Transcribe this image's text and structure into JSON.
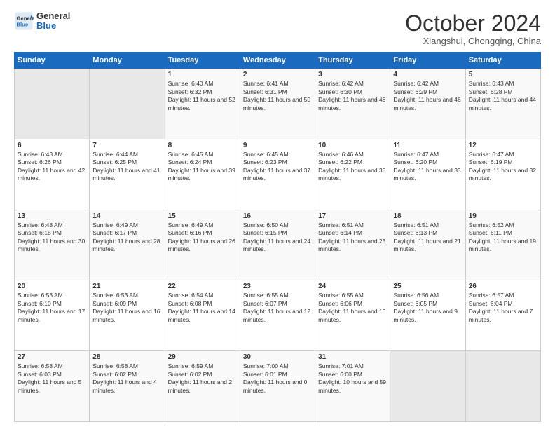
{
  "header": {
    "logo_line1": "General",
    "logo_line2": "Blue",
    "month": "October 2024",
    "location": "Xiangshui, Chongqing, China"
  },
  "weekdays": [
    "Sunday",
    "Monday",
    "Tuesday",
    "Wednesday",
    "Thursday",
    "Friday",
    "Saturday"
  ],
  "weeks": [
    [
      {
        "day": "",
        "empty": true
      },
      {
        "day": "",
        "empty": true
      },
      {
        "day": "1",
        "sunrise": "6:40 AM",
        "sunset": "6:32 PM",
        "daylight": "11 hours and 52 minutes."
      },
      {
        "day": "2",
        "sunrise": "6:41 AM",
        "sunset": "6:31 PM",
        "daylight": "11 hours and 50 minutes."
      },
      {
        "day": "3",
        "sunrise": "6:42 AM",
        "sunset": "6:30 PM",
        "daylight": "11 hours and 48 minutes."
      },
      {
        "day": "4",
        "sunrise": "6:42 AM",
        "sunset": "6:29 PM",
        "daylight": "11 hours and 46 minutes."
      },
      {
        "day": "5",
        "sunrise": "6:43 AM",
        "sunset": "6:28 PM",
        "daylight": "11 hours and 44 minutes."
      }
    ],
    [
      {
        "day": "6",
        "sunrise": "6:43 AM",
        "sunset": "6:26 PM",
        "daylight": "11 hours and 42 minutes."
      },
      {
        "day": "7",
        "sunrise": "6:44 AM",
        "sunset": "6:25 PM",
        "daylight": "11 hours and 41 minutes."
      },
      {
        "day": "8",
        "sunrise": "6:45 AM",
        "sunset": "6:24 PM",
        "daylight": "11 hours and 39 minutes."
      },
      {
        "day": "9",
        "sunrise": "6:45 AM",
        "sunset": "6:23 PM",
        "daylight": "11 hours and 37 minutes."
      },
      {
        "day": "10",
        "sunrise": "6:46 AM",
        "sunset": "6:22 PM",
        "daylight": "11 hours and 35 minutes."
      },
      {
        "day": "11",
        "sunrise": "6:47 AM",
        "sunset": "6:20 PM",
        "daylight": "11 hours and 33 minutes."
      },
      {
        "day": "12",
        "sunrise": "6:47 AM",
        "sunset": "6:19 PM",
        "daylight": "11 hours and 32 minutes."
      }
    ],
    [
      {
        "day": "13",
        "sunrise": "6:48 AM",
        "sunset": "6:18 PM",
        "daylight": "11 hours and 30 minutes."
      },
      {
        "day": "14",
        "sunrise": "6:49 AM",
        "sunset": "6:17 PM",
        "daylight": "11 hours and 28 minutes."
      },
      {
        "day": "15",
        "sunrise": "6:49 AM",
        "sunset": "6:16 PM",
        "daylight": "11 hours and 26 minutes."
      },
      {
        "day": "16",
        "sunrise": "6:50 AM",
        "sunset": "6:15 PM",
        "daylight": "11 hours and 24 minutes."
      },
      {
        "day": "17",
        "sunrise": "6:51 AM",
        "sunset": "6:14 PM",
        "daylight": "11 hours and 23 minutes."
      },
      {
        "day": "18",
        "sunrise": "6:51 AM",
        "sunset": "6:13 PM",
        "daylight": "11 hours and 21 minutes."
      },
      {
        "day": "19",
        "sunrise": "6:52 AM",
        "sunset": "6:11 PM",
        "daylight": "11 hours and 19 minutes."
      }
    ],
    [
      {
        "day": "20",
        "sunrise": "6:53 AM",
        "sunset": "6:10 PM",
        "daylight": "11 hours and 17 minutes."
      },
      {
        "day": "21",
        "sunrise": "6:53 AM",
        "sunset": "6:09 PM",
        "daylight": "11 hours and 16 minutes."
      },
      {
        "day": "22",
        "sunrise": "6:54 AM",
        "sunset": "6:08 PM",
        "daylight": "11 hours and 14 minutes."
      },
      {
        "day": "23",
        "sunrise": "6:55 AM",
        "sunset": "6:07 PM",
        "daylight": "11 hours and 12 minutes."
      },
      {
        "day": "24",
        "sunrise": "6:55 AM",
        "sunset": "6:06 PM",
        "daylight": "11 hours and 10 minutes."
      },
      {
        "day": "25",
        "sunrise": "6:56 AM",
        "sunset": "6:05 PM",
        "daylight": "11 hours and 9 minutes."
      },
      {
        "day": "26",
        "sunrise": "6:57 AM",
        "sunset": "6:04 PM",
        "daylight": "11 hours and 7 minutes."
      }
    ],
    [
      {
        "day": "27",
        "sunrise": "6:58 AM",
        "sunset": "6:03 PM",
        "daylight": "11 hours and 5 minutes."
      },
      {
        "day": "28",
        "sunrise": "6:58 AM",
        "sunset": "6:02 PM",
        "daylight": "11 hours and 4 minutes."
      },
      {
        "day": "29",
        "sunrise": "6:59 AM",
        "sunset": "6:02 PM",
        "daylight": "11 hours and 2 minutes."
      },
      {
        "day": "30",
        "sunrise": "7:00 AM",
        "sunset": "6:01 PM",
        "daylight": "11 hours and 0 minutes."
      },
      {
        "day": "31",
        "sunrise": "7:01 AM",
        "sunset": "6:00 PM",
        "daylight": "10 hours and 59 minutes."
      },
      {
        "day": "",
        "empty": true
      },
      {
        "day": "",
        "empty": true
      }
    ]
  ],
  "labels": {
    "sunrise": "Sunrise:",
    "sunset": "Sunset:",
    "daylight": "Daylight:"
  }
}
